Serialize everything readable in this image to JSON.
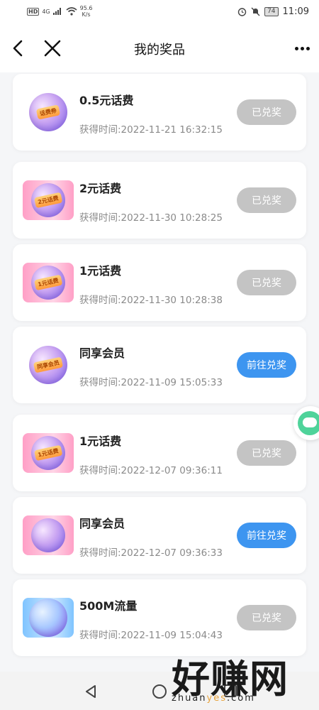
{
  "status_bar": {
    "hd": "HD",
    "network": "4G",
    "speed_value": "95.6",
    "speed_unit": "K/s",
    "battery": "74",
    "time": "11:09"
  },
  "header": {
    "title": "我的奖品",
    "back_icon": "chevron-left-icon",
    "close_icon": "close-icon",
    "more_icon": "more-dots-icon"
  },
  "prizes": [
    {
      "name": "0.5元话费",
      "time": "获得时间:2022-11-21 16:32:15",
      "button": "已兑奖",
      "status": "done",
      "thumb_style": "round",
      "thumb_tag": "话费券"
    },
    {
      "name": "2元话费",
      "time": "获得时间:2022-11-30 10:28:25",
      "button": "已兑奖",
      "status": "done",
      "thumb_style": "pink",
      "thumb_tag": "2元话费"
    },
    {
      "name": "1元话费",
      "time": "获得时间:2022-11-30 10:28:38",
      "button": "已兑奖",
      "status": "done",
      "thumb_style": "pink",
      "thumb_tag": "1元话费"
    },
    {
      "name": "同享会员",
      "time": "获得时间:2022-11-09 15:05:33",
      "button": "前往兑奖",
      "status": "go",
      "thumb_style": "round",
      "thumb_tag": "同享会员"
    },
    {
      "name": "1元话费",
      "time": "获得时间:2022-12-07 09:36:11",
      "button": "已兑奖",
      "status": "done",
      "thumb_style": "pink",
      "thumb_tag": "1元话费"
    },
    {
      "name": "同享会员",
      "time": "获得时间:2022-12-07 09:36:33",
      "button": "前往兑奖",
      "status": "go",
      "thumb_style": "pink",
      "thumb_tag": ""
    },
    {
      "name": "500M流量",
      "time": "获得时间:2022-11-09 15:04:43",
      "button": "已兑奖",
      "status": "done",
      "thumb_style": "blue",
      "thumb_tag": ""
    }
  ],
  "colors": {
    "done_button": "#c4c4c4",
    "go_button": "#3d95f0",
    "watermark_accent": "#e8a33c"
  },
  "watermark": {
    "big": "好赚网",
    "small_pre": "zhuan",
    "small_accent": "yes",
    "small_post": ".com"
  }
}
